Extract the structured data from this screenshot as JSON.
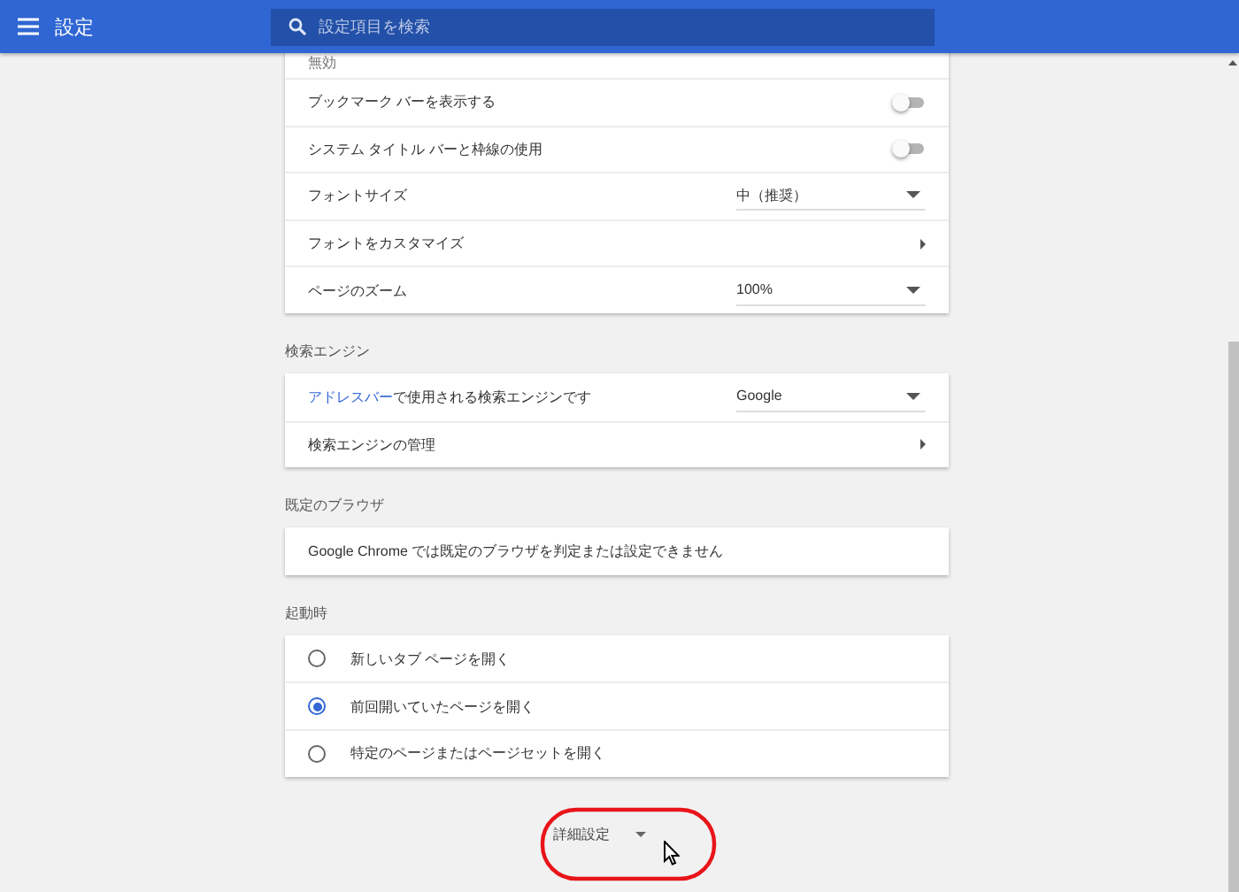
{
  "header": {
    "title": "設定",
    "search": {
      "placeholder": "設定項目を検索"
    }
  },
  "sections": [
    {
      "rows": [
        {
          "kind": "cut",
          "label": "無効"
        },
        {
          "kind": "toggle",
          "label": "ブックマーク バーを表示する",
          "on": false
        },
        {
          "kind": "toggle",
          "label": "システム タイトル バーと枠線の使用",
          "on": false
        },
        {
          "kind": "select",
          "label": "フォントサイズ",
          "value": "中（推奨）"
        },
        {
          "kind": "link",
          "label": "フォントをカスタマイズ"
        },
        {
          "kind": "select",
          "label": "ページのズーム",
          "value": "100%"
        }
      ]
    },
    {
      "heading": "検索エンジン",
      "rows": [
        {
          "kind": "select",
          "link": "アドレスバー",
          "label": "で使用される検索エンジンです",
          "value": "Google"
        },
        {
          "kind": "link",
          "label": "検索エンジンの管理"
        }
      ]
    },
    {
      "heading": "既定のブラウザ",
      "rows": [
        {
          "kind": "text",
          "label": "Google Chrome では既定のブラウザを判定または設定できません"
        }
      ]
    },
    {
      "heading": "起動時",
      "rows": [
        {
          "kind": "radio",
          "label": "新しいタブ ページを開く",
          "selected": false
        },
        {
          "kind": "radio",
          "label": "前回開いていたページを開く",
          "selected": true
        },
        {
          "kind": "radio",
          "label": "特定のページまたはページセットを開く",
          "selected": false
        }
      ]
    }
  ],
  "advanced": {
    "label": "詳細設定",
    "highlighted": true
  }
}
